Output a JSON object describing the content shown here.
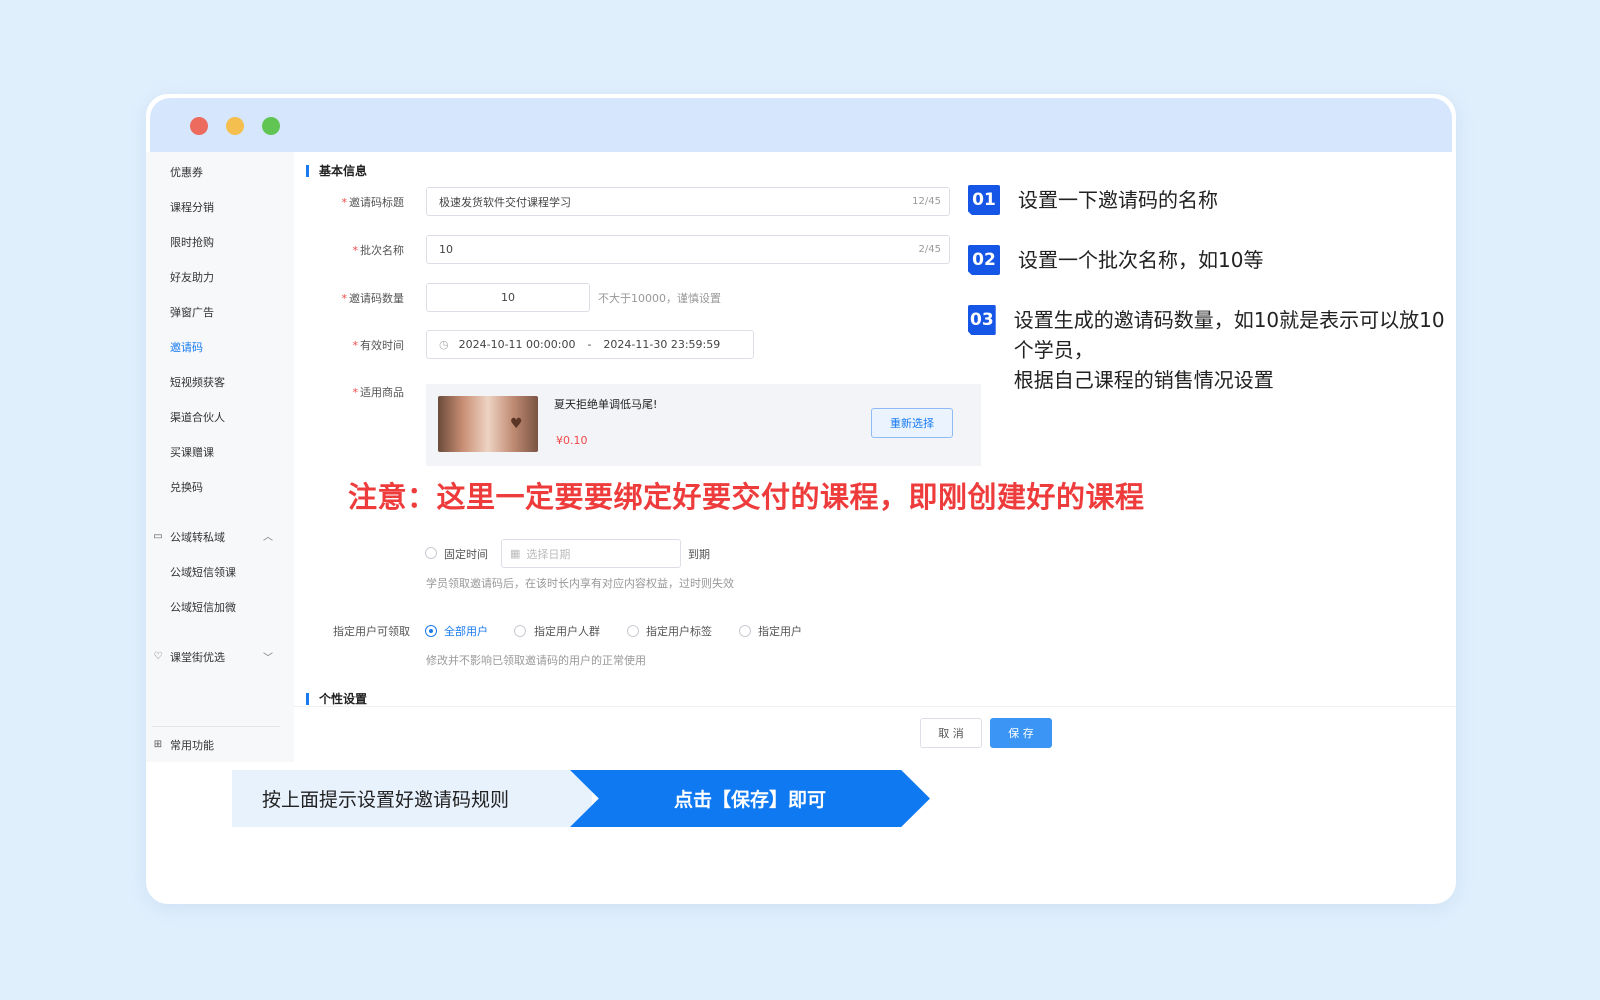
{
  "sidebar": {
    "items": [
      "优惠券",
      "课程分销",
      "限时抢购",
      "好友助力",
      "弹窗广告",
      "邀请码",
      "短视频获客",
      "渠道合伙人",
      "买课赠课",
      "兑换码"
    ],
    "active_item": "邀请码",
    "group1": {
      "label": "公域转私域",
      "items": [
        "公域短信领课",
        "公域短信加微"
      ]
    },
    "group2": {
      "label": "课堂街优选"
    },
    "bottom": "常用功能"
  },
  "form": {
    "section_basic": "基本信息",
    "title_label": "邀请码标题",
    "title_value": "极速发货软件交付课程学习",
    "title_count": "12/45",
    "batch_label": "批次名称",
    "batch_value": "10",
    "batch_count": "2/45",
    "qty_label": "邀请码数量",
    "qty_value": "10",
    "qty_hint": "不大于10000，谨慎设置",
    "time_label": "有效时间",
    "time_start": "2024-10-11 00:00:00",
    "time_sep": "-",
    "time_end": "2024-11-30 23:59:59",
    "goods_label": "适用商品",
    "product_name": "夏天拒绝单调低马尾!",
    "product_price": "¥0.10",
    "reselect": "重新选择",
    "fixed_time_label": "固定时间",
    "date_placeholder": "选择日期",
    "expire_suffix": "到期",
    "validity_hint": "学员领取邀请码后，在该时长内享有对应内容权益，过时则失效",
    "user_label": "指定用户可领取",
    "user_options": [
      "全部用户",
      "指定用户人群",
      "指定用户标签",
      "指定用户"
    ],
    "user_hint": "修改并不影响已领取邀请码的用户的正常使用",
    "section_personal": "个性设置",
    "cancel": "取 消",
    "save": "保 存"
  },
  "notice": "注意：这里一定要要绑定好要交付的课程，即刚创建好的课程",
  "steps": [
    {
      "num": "01",
      "text": "设置一下邀请码的名称"
    },
    {
      "num": "02",
      "text": "设置一个批次名称，如10等"
    },
    {
      "num": "03",
      "text": "设置生成的邀请码数量，如10就是表示可以放10个学员，",
      "text2": "根据自己课程的销售情况设置"
    }
  ],
  "banner": {
    "left": "按上面提示设置好邀请码规则",
    "right": "点击【保存】即可"
  },
  "colors": {
    "accent": "#1a7bf0",
    "notice": "#ee3c3c",
    "banner": "#0f79f2",
    "badge": "#1656e6"
  }
}
